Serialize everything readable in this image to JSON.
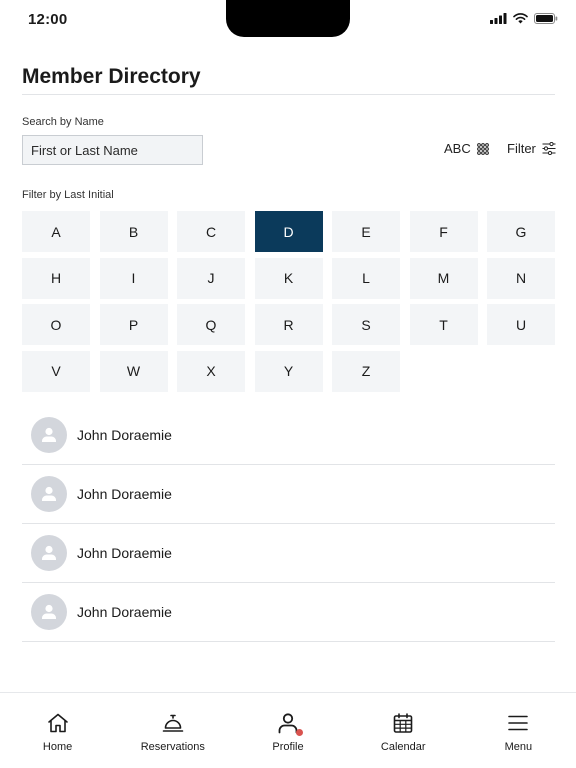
{
  "status_bar": {
    "time": "12:00"
  },
  "page": {
    "title": "Member Directory"
  },
  "search": {
    "label": "Search by Name",
    "placeholder": "First or Last Name"
  },
  "controls": {
    "sort_label": "ABC",
    "filter_label": "Filter"
  },
  "initials": {
    "label": "Filter by Last Initial",
    "selected": "D",
    "letters": [
      "A",
      "B",
      "C",
      "D",
      "E",
      "F",
      "G",
      "H",
      "I",
      "J",
      "K",
      "L",
      "M",
      "N",
      "O",
      "P",
      "Q",
      "R",
      "S",
      "T",
      "U",
      "V",
      "W",
      "X",
      "Y",
      "Z"
    ]
  },
  "members": [
    {
      "name": "John Doraemie"
    },
    {
      "name": "John Doraemie"
    },
    {
      "name": "John Doraemie"
    },
    {
      "name": "John Doraemie"
    }
  ],
  "tabs": [
    {
      "label": "Home",
      "icon": "home-icon"
    },
    {
      "label": "Reservations",
      "icon": "service-bell-icon"
    },
    {
      "label": "Profile",
      "icon": "profile-icon",
      "has_notification": true
    },
    {
      "label": "Calendar",
      "icon": "calendar-icon"
    },
    {
      "label": "Menu",
      "icon": "menu-icon"
    }
  ],
  "colors": {
    "accent": "#0b3a5b",
    "tile": "#f3f5f7",
    "notification": "#d9534f"
  }
}
